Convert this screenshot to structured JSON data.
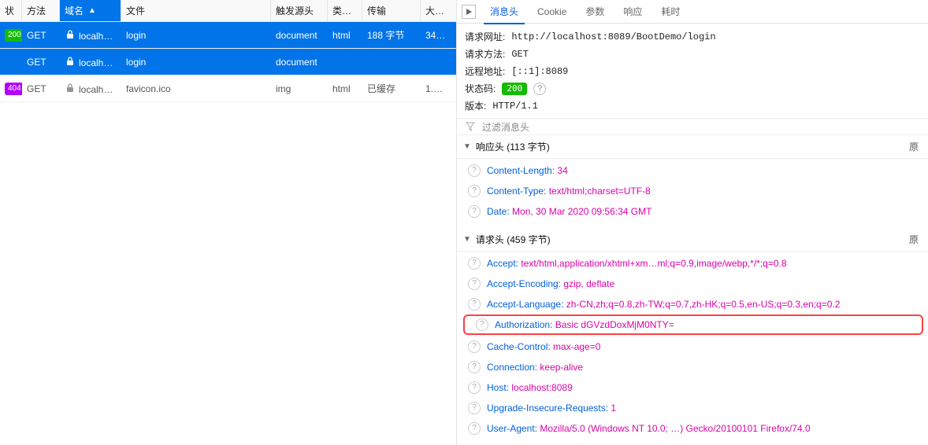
{
  "leftPanel": {
    "columns": {
      "status": "状",
      "method": "方法",
      "domain": "域名",
      "file": "文件",
      "initiator": "触发源头",
      "type": "类…",
      "transferred": "传输",
      "size": "大…"
    },
    "sort_indicator": "▲",
    "rows": [
      {
        "statusBadge": "200",
        "badgeClass": "green",
        "selected": true,
        "method": "GET",
        "lockColor": "#ffffff",
        "domain": "localh…",
        "file": "login",
        "initiator": "document",
        "type": "html",
        "transferred": "188 字节",
        "size": "34…"
      },
      {
        "statusBadge": "",
        "badgeClass": "",
        "selected": true,
        "method": "GET",
        "lockColor": "#ffffff",
        "domain": "localh…",
        "file": "login",
        "initiator": "document",
        "type": "",
        "transferred": "",
        "size": ""
      },
      {
        "statusBadge": "404",
        "badgeClass": "purple",
        "selected": false,
        "method": "GET",
        "lockColor": "#969696",
        "domain": "localh…",
        "file": "favicon.ico",
        "initiator": "img",
        "type": "html",
        "transferred": "已缓存",
        "size": "1.0…"
      }
    ]
  },
  "rightPanel": {
    "tabs": [
      "消息头",
      "Cookie",
      "参数",
      "响应",
      "耗时"
    ],
    "activeTab": 0,
    "summary": {
      "urlLabel": "请求网址:",
      "url": "http://localhost:8089/BootDemo/login",
      "methodLabel": "请求方法:",
      "method": "GET",
      "remoteLabel": "远程地址:",
      "remote": "[::1]:8089",
      "statusLabel": "状态码:",
      "statusCode": "200",
      "versionLabel": "版本:",
      "version": "HTTP/1.1"
    },
    "filterPlaceholder": "过滤消息头",
    "sections": [
      {
        "title": "响应头 (113 字节)",
        "rawLabel": "原",
        "headers": [
          {
            "name": "Content-Length:",
            "value": "34",
            "highlight": false
          },
          {
            "name": "Content-Type:",
            "value": "text/html;charset=UTF-8",
            "highlight": false
          },
          {
            "name": "Date:",
            "value": "Mon, 30 Mar 2020 09:56:34 GMT",
            "highlight": false
          }
        ]
      },
      {
        "title": "请求头 (459 字节)",
        "rawLabel": "原",
        "headers": [
          {
            "name": "Accept:",
            "value": "text/html,application/xhtml+xm…ml;q=0.9,image/webp,*/*;q=0.8",
            "highlight": false
          },
          {
            "name": "Accept-Encoding:",
            "value": "gzip, deflate",
            "highlight": false
          },
          {
            "name": "Accept-Language:",
            "value": "zh-CN,zh;q=0.8,zh-TW;q=0.7,zh-HK;q=0.5,en-US;q=0.3,en;q=0.2",
            "highlight": false
          },
          {
            "name": "Authorization:",
            "value": "Basic dGVzdDoxMjM0NTY=",
            "highlight": true
          },
          {
            "name": "Cache-Control:",
            "value": "max-age=0",
            "highlight": false
          },
          {
            "name": "Connection:",
            "value": "keep-alive",
            "highlight": false
          },
          {
            "name": "Host:",
            "value": "localhost:8089",
            "highlight": false
          },
          {
            "name": "Upgrade-Insecure-Requests:",
            "value": "1",
            "highlight": false
          },
          {
            "name": "User-Agent:",
            "value": "Mozilla/5.0 (Windows NT 10.0; …) Gecko/20100101 Firefox/74.0",
            "highlight": false
          }
        ]
      }
    ]
  }
}
